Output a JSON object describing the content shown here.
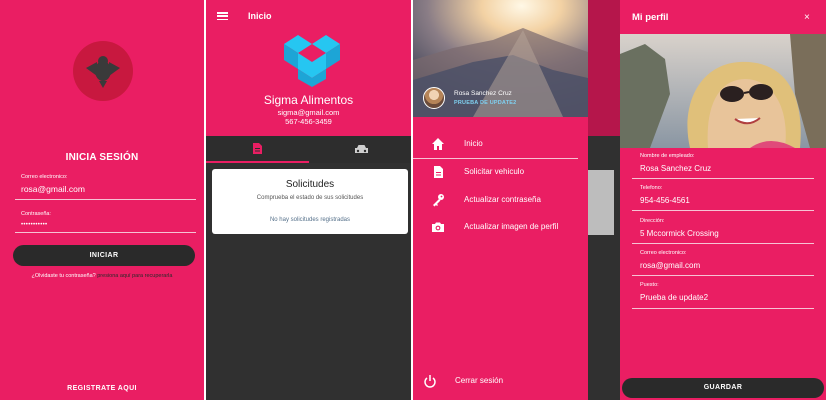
{
  "login": {
    "title": "INICIA SESIÓN",
    "email_label": "Correo electronico:",
    "email_value": "rosa@gmail.com",
    "password_label": "Contraseña:",
    "password_value": "•••••••••••",
    "login_button": "INICIAR",
    "forgot_text": "¿Olvidaste tu contraseña?",
    "forgot_link": "presiona aquí para recuperarla",
    "register": "REGISTRATE AQUI"
  },
  "home": {
    "title": "Inicio",
    "company": "Sigma Alimentos",
    "email": "sigma@gmail.com",
    "phone": "567-456-3459",
    "tabs": [
      {
        "icon": "document-icon"
      },
      {
        "icon": "car-icon"
      }
    ],
    "card": {
      "title": "Solicitudes",
      "subtitle": "Comprueba el estado de sus solicitudes",
      "empty": "No hay solicitudes registradas"
    }
  },
  "drawer": {
    "user_name": "Rosa Sanchez Cruz",
    "user_subtitle": "PRUEBA DE UPDATE2",
    "items": [
      {
        "label": "Inicio",
        "icon": "home-icon"
      },
      {
        "label": "Solicitar vehiculo",
        "icon": "document-icon"
      },
      {
        "label": "Actualizar contraseña",
        "icon": "key-icon"
      },
      {
        "label": "Actualizar imagen de perfil",
        "icon": "camera-icon"
      }
    ],
    "logout": {
      "label": "Cerrar sesión",
      "icon": "power-icon"
    }
  },
  "profile": {
    "title": "Mi perfil",
    "close": "×",
    "fields": [
      {
        "label": "Nombre de empleado:",
        "value": "Rosa Sanchez Cruz"
      },
      {
        "label": "Telefono:",
        "value": "954-456-4561"
      },
      {
        "label": "Dirección:",
        "value": "5 Mccormick Crossing"
      },
      {
        "label": "Correo electronico:",
        "value": "rosa@gmail.com"
      },
      {
        "label": "Puesto:",
        "value": "Prueba de update2"
      }
    ],
    "save_button": "GUARDAR"
  },
  "colors": {
    "primary": "#ea1e63",
    "dark": "#2a2a2a",
    "accent_text": "#7fd0f0"
  }
}
